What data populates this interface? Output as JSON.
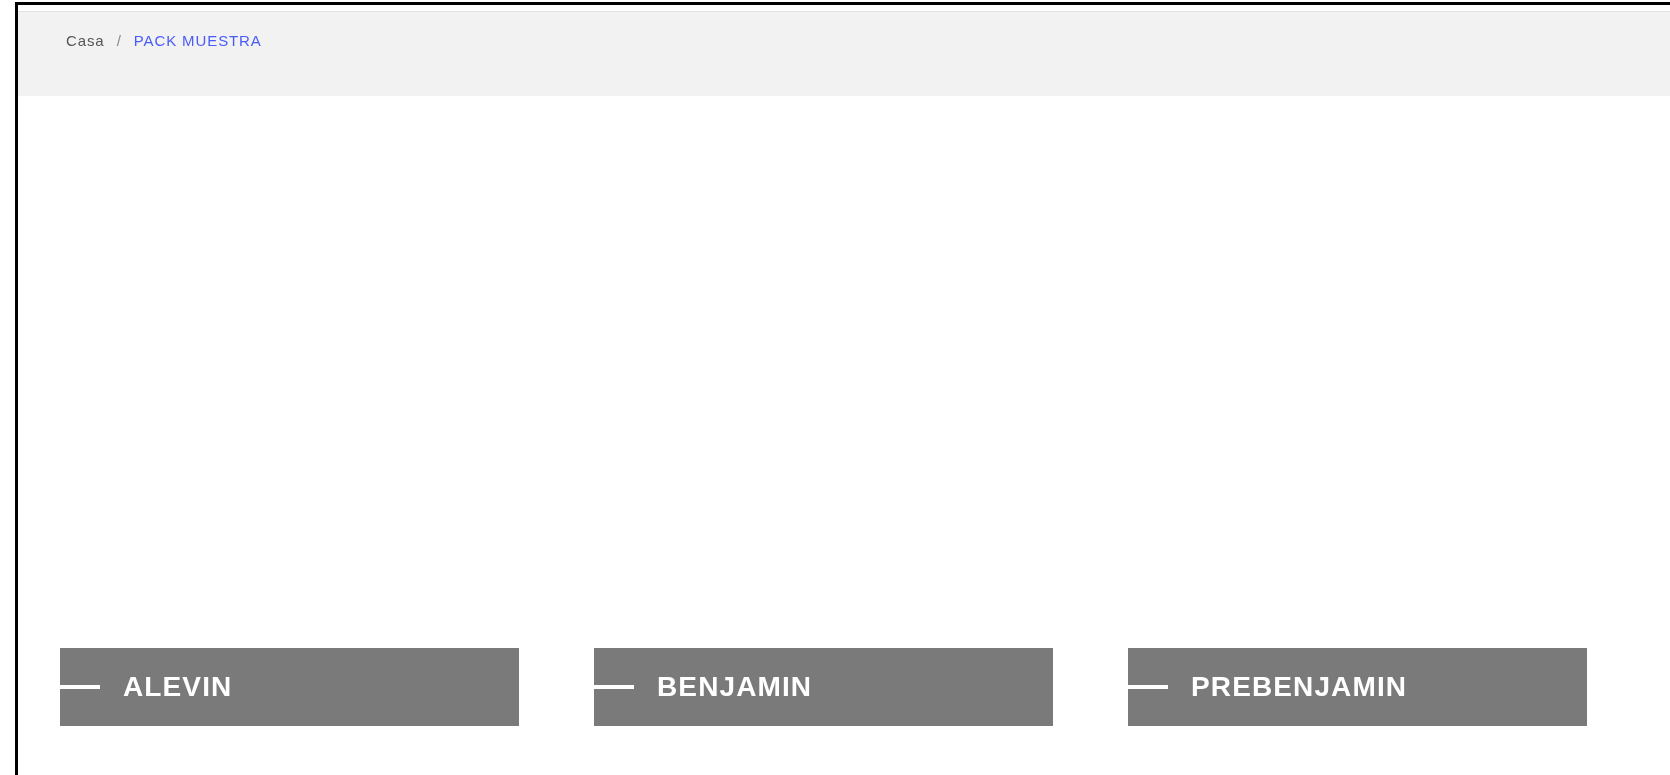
{
  "breadcrumb": {
    "items": [
      {
        "label": "Casa",
        "selected": false
      },
      {
        "label": "PACK MUESTRA",
        "selected": true
      }
    ],
    "separator": "/"
  },
  "categories": [
    {
      "label": "ALEVIN"
    },
    {
      "label": "BENJAMIN"
    },
    {
      "label": "PREBENJAMIN"
    }
  ]
}
